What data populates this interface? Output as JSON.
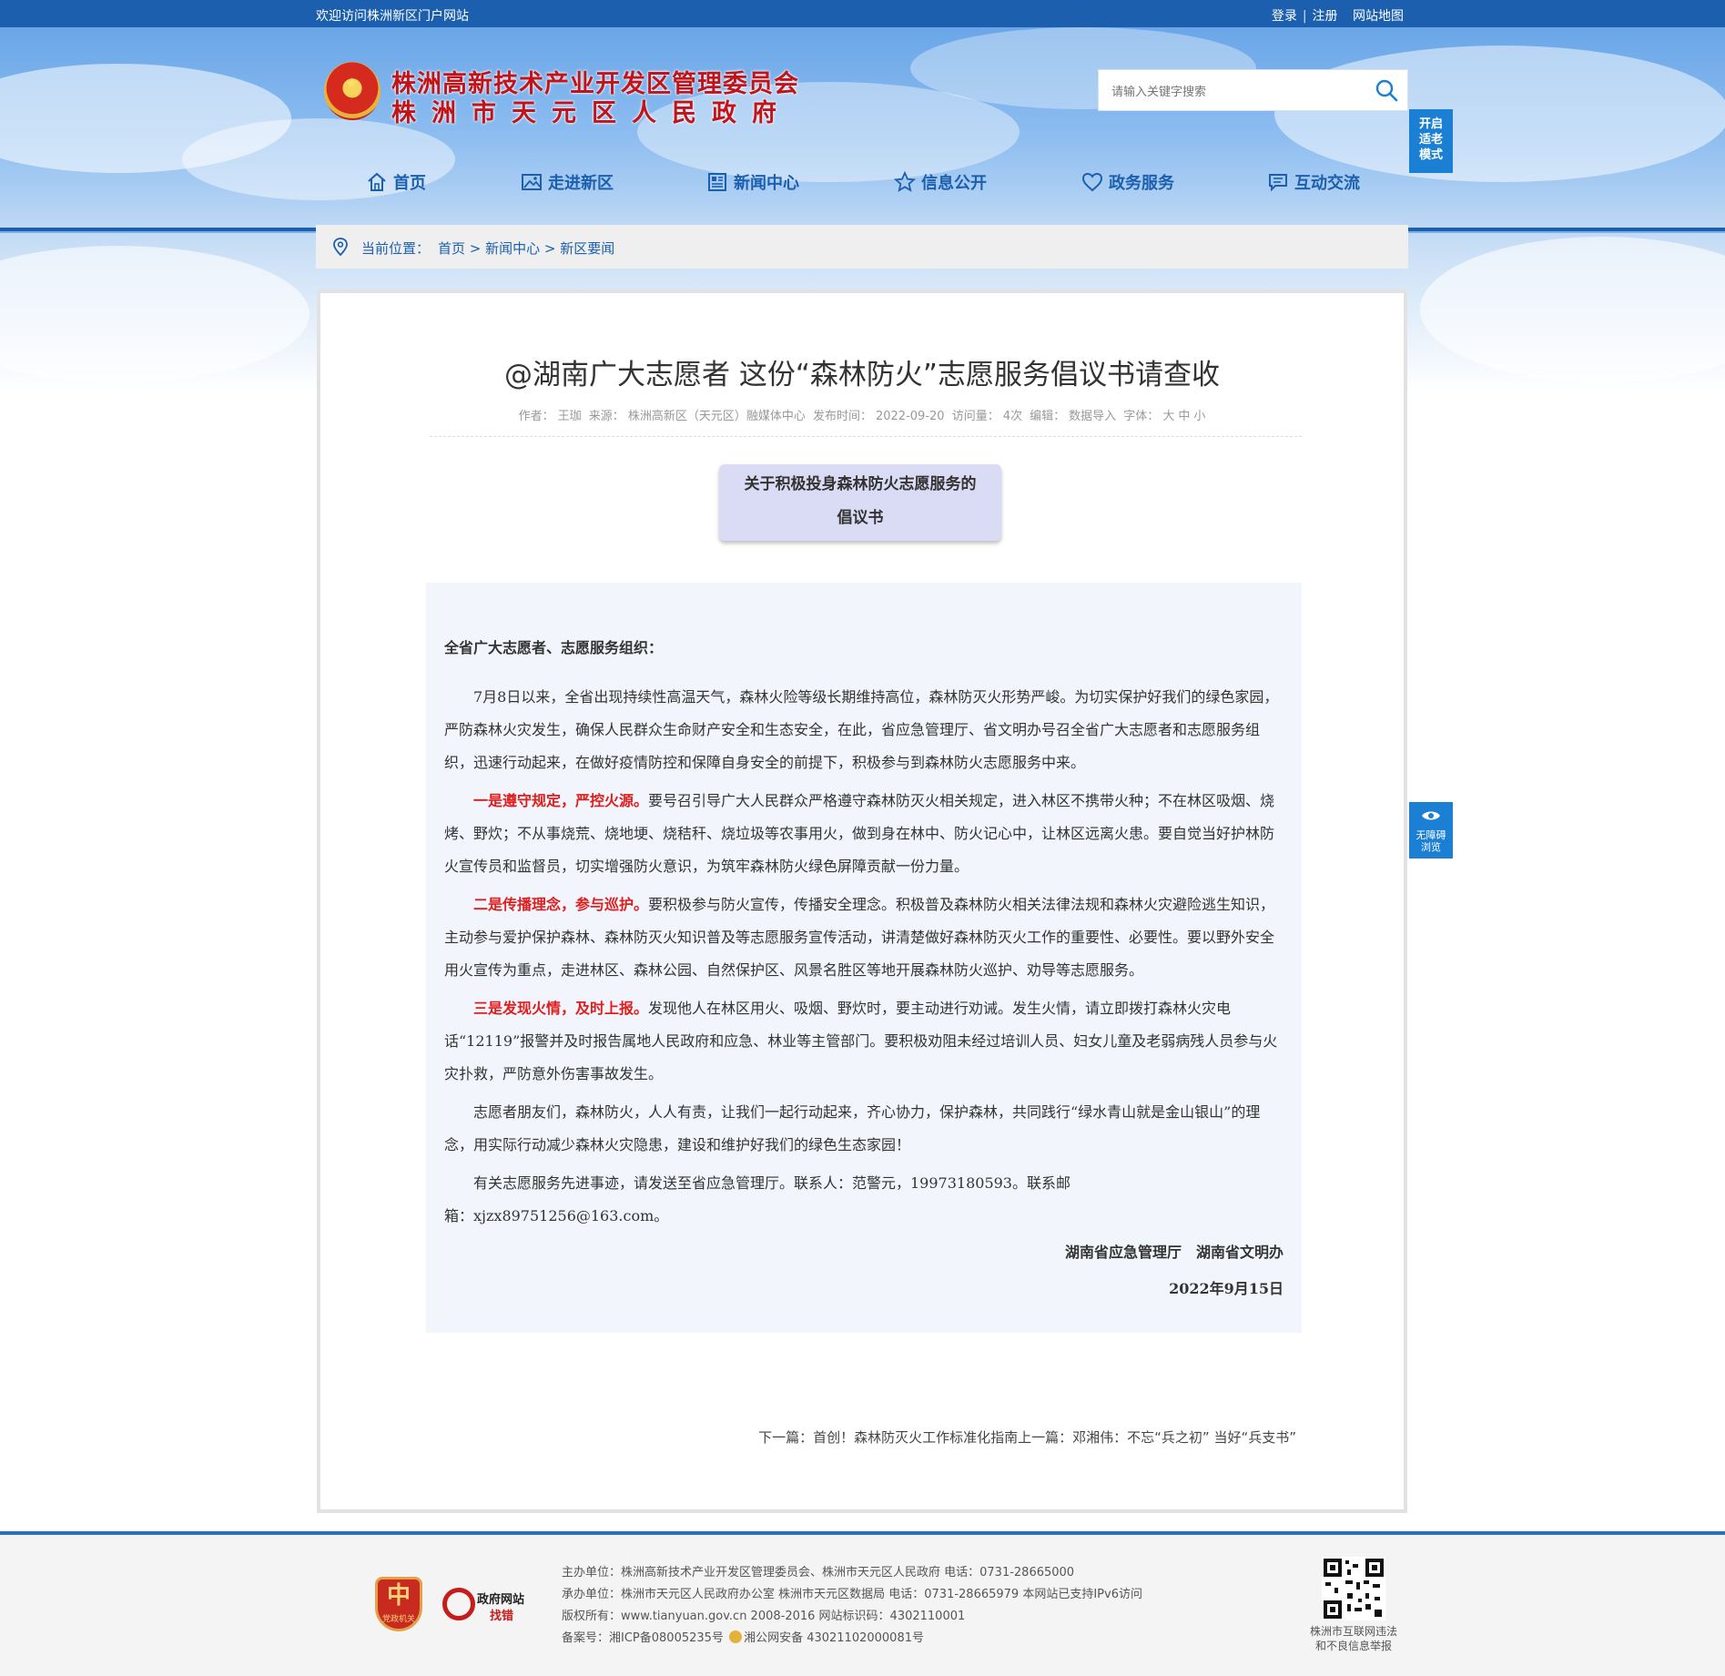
{
  "topbar": {
    "welcome": "欢迎访问株洲新区门户网站",
    "links": [
      "登录",
      "注册",
      "网站地图"
    ]
  },
  "header": {
    "title_line1": "株洲高新技术产业开发区管理委员会",
    "title_line2": "株洲市天元区人民政府",
    "search_placeholder": "请输入关键字搜索",
    "elder_mode": [
      "开启",
      "适老",
      "模式"
    ]
  },
  "nav": {
    "items": [
      {
        "label": "首页",
        "icon": "home-icon"
      },
      {
        "label": "走进新区",
        "icon": "picture-icon"
      },
      {
        "label": "新闻中心",
        "icon": "news-icon"
      },
      {
        "label": "信息公开",
        "icon": "star-icon"
      },
      {
        "label": "政务服务",
        "icon": "heart-icon"
      },
      {
        "label": "互动交流",
        "icon": "chat-icon"
      }
    ]
  },
  "breadcrumb": {
    "label": "当前位置：",
    "items": [
      "首页",
      "新闻中心",
      "新区要闻"
    ]
  },
  "article": {
    "title": "@湖南广大志愿者 这份“森林防火”志愿服务倡议书请查收",
    "meta": {
      "author_label": "作者：",
      "author": "王珈",
      "source_label": "来源：",
      "source": "株洲高新区（天元区）融媒体中心",
      "date_label": "发布时间：",
      "date": "2022-09-20",
      "views_label": "访问量：",
      "views": "4次",
      "editor_label": "编辑：",
      "editor": "数据导入",
      "font_label": "字体：",
      "font_sizes": [
        "大",
        "中",
        "小"
      ]
    },
    "proposal_title": [
      "关于积极投身森林防火志愿服务的",
      "倡议书"
    ],
    "salutation": "全省广大志愿者、志愿服务组织：",
    "para1": "7月8日以来，全省出现持续性高温天气，森林火险等级长期维持高位，森林防灭火形势严峻。为切实保护好我们的绿色家园，严防森林火灾发生，确保人民群众生命财产安全和生态安全，在此，省应急管理厅、省文明办号召全省广大志愿者和志愿服务组织，迅速行动起来，在做好疫情防控和保障自身安全的前提下，积极参与到森林防火志愿服务中来。",
    "point1_head": "一是遵守规定，严控火源。",
    "point1_body": "要号召引导广大人民群众严格遵守森林防灭火相关规定，进入林区不携带火种；不在林区吸烟、烧烤、野炊；不从事烧荒、烧地埂、烧秸秆、烧垃圾等农事用火，做到身在林中、防火记心中，让林区远离火患。要自觉当好护林防火宣传员和监督员，切实增强防火意识，为筑牢森林防火绿色屏障贡献一份力量。",
    "point2_head": "二是传播理念，参与巡护。",
    "point2_body": "要积极参与防火宣传，传播安全理念。积极普及森林防火相关法律法规和森林火灾避险逃生知识，主动参与爱护保护森林、森林防灭火知识普及等志愿服务宣传活动，讲清楚做好森林防灭火工作的重要性、必要性。要以野外安全用火宣传为重点，走进林区、森林公园、自然保护区、风景名胜区等地开展森林防火巡护、劝导等志愿服务。",
    "point3_head": "三是发现火情，及时上报。",
    "point3_body": "发现他人在林区用火、吸烟、野炊时，要主动进行劝诫。发生火情，请立即拨打森林火灾电话“12119”报警并及时报告属地人民政府和应急、林业等主管部门。要积极劝阻未经过培训人员、妇女儿童及老弱病残人员参与火灾扑救，严防意外伤害事故发生。",
    "para_close": "志愿者朋友们，森林防火，人人有责，让我们一起行动起来，齐心协力，保护森林，共同践行“绿水青山就是金山银山”的理念，用实际行动减少森林火灾隐患，建设和维护好我们的绿色生态家园！",
    "contact_line1": "有关志愿服务先进事迹，请发送至省应急管理厅。联系人：范警元，19973180593。联系邮",
    "contact_line2": "箱：xjzx89751256@163.com。",
    "signature": "湖南省应急管理厅　湖南省文明办",
    "sign_date": "2022年9月15日",
    "next_label": "下一篇：",
    "next_title": "首创！森林防灭火工作标准化指南",
    "prev_label": "上一篇：",
    "prev_title": "邓湘伟：不忘“兵之初” 当好“兵支书”"
  },
  "accessibility": [
    "无障碍",
    "浏览"
  ],
  "footer": {
    "badge1_text": "党政机关",
    "badge2_line1": "政府网站",
    "badge2_line2": "找错",
    "lines": [
      "主办单位：株洲高新技术产业开发区管理委员会、株洲市天元区人民政府 电话：0731-28665000",
      "承办单位：株洲市天元区人民政府办公室 株洲市天元区数据局 电话：0731-28665979 本网站已支持IPv6访问",
      "版权所有：www.tianyuan.gov.cn 2008-2016 网站标识码：4302110001",
      "备案号：湘ICP备08005235号 ",
      "湘公网安备 43021102000081号"
    ],
    "qr_caption": [
      "株洲市互联网违法",
      "和不良信息举报"
    ]
  },
  "colors": {
    "brand_blue": "#1b5fae",
    "title_red": "#c1141a",
    "highlight_red": "#e01d1d",
    "side_button": "#1b7fd4"
  }
}
